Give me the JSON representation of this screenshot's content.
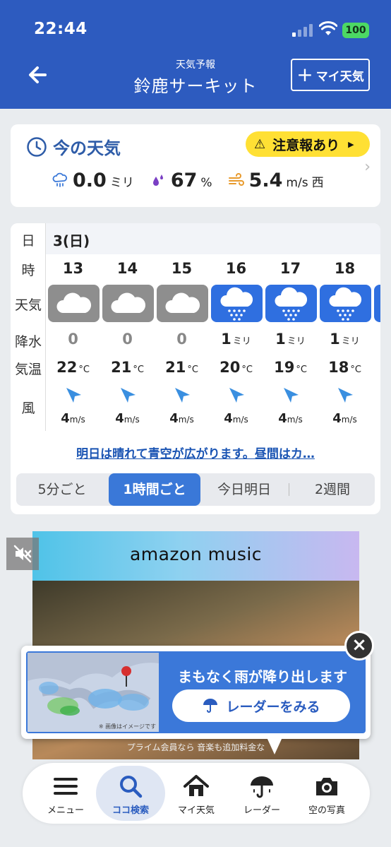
{
  "status_bar": {
    "time": "22:44",
    "battery": "100"
  },
  "header": {
    "subtitle": "天気予報",
    "title": "鈴鹿サーキット",
    "my_weather_label": "マイ天気"
  },
  "now": {
    "title": "今の天気",
    "alert": "注意報あり",
    "precip": {
      "value": "0.0",
      "unit": "ミリ"
    },
    "humidity": {
      "value": "67",
      "unit": "%"
    },
    "wind": {
      "value": "5.4",
      "unit": "m/s",
      "dir": "西"
    }
  },
  "hourly": {
    "row_labels": [
      "日",
      "時",
      "天気",
      "降水",
      "気温",
      "風"
    ],
    "date": "3(日)",
    "temp_unit": "°C",
    "wind_unit": "m/s",
    "precip_unit": "ミリ",
    "hours": [
      {
        "hour": "13",
        "icon": "cloud-icon",
        "precip": "0",
        "temp": "22",
        "wind": "4"
      },
      {
        "hour": "14",
        "icon": "cloud-icon",
        "precip": "0",
        "temp": "21",
        "wind": "4"
      },
      {
        "hour": "15",
        "icon": "cloud-icon",
        "precip": "0",
        "temp": "21",
        "wind": "4"
      },
      {
        "hour": "16",
        "icon": "rain-icon",
        "precip": "1",
        "temp": "20",
        "wind": "4"
      },
      {
        "hour": "17",
        "icon": "rain-icon",
        "precip": "1",
        "temp": "19",
        "wind": "4"
      },
      {
        "hour": "18",
        "icon": "rain-icon",
        "precip": "1",
        "temp": "18",
        "wind": "4"
      }
    ],
    "forecast_text": "明日は晴れて青空が広がります。昼間はカ…",
    "tabs": [
      "5分ごと",
      "1時間ごと",
      "今日明日",
      "2週間"
    ],
    "active_tab": "1時間ごと"
  },
  "ad": {
    "brand": "amazon music",
    "footer": "プライム会員なら 音楽も追加料金な"
  },
  "rain_popup": {
    "message": "まもなく雨が降り出します",
    "button": "レーダーをみる",
    "map_note": "※ 画像はイメージです"
  },
  "bottom_nav": [
    {
      "label": "メニュー",
      "icon": "menu-icon"
    },
    {
      "label": "ココ検索",
      "icon": "search-icon",
      "active": true
    },
    {
      "label": "マイ天気",
      "icon": "home-icon"
    },
    {
      "label": "レーダー",
      "icon": "umbrella-icon"
    },
    {
      "label": "空の写真",
      "icon": "camera-icon"
    }
  ],
  "colors": {
    "header_bg": "#2d5bbf",
    "alert_bg": "#ffe034",
    "rain_icon_bg": "#2f6fe0",
    "cloud_icon_bg": "#8e8e8e",
    "accent": "#3a78d8"
  }
}
